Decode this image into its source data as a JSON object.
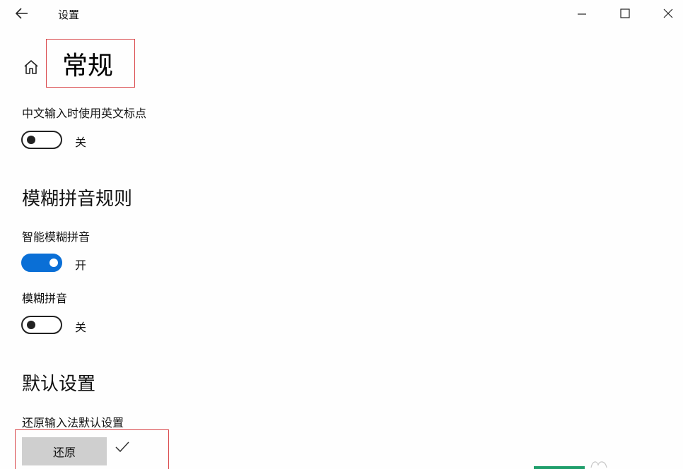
{
  "window": {
    "title": "设置"
  },
  "header": {
    "page_title": "常规"
  },
  "settings": {
    "english_punct": {
      "label": "中文输入时使用英文标点",
      "state_text": "关",
      "on": false
    },
    "fuzzy_section_title": "模糊拼音规则",
    "smart_fuzzy": {
      "label": "智能模糊拼音",
      "state_text": "开",
      "on": true
    },
    "fuzzy": {
      "label": "模糊拼音",
      "state_text": "关",
      "on": false
    },
    "default_section_title": "默认设置",
    "restore": {
      "label": "还原输入法默认设置",
      "button_label": "还原"
    }
  },
  "icons": {
    "back": "back-arrow-icon",
    "home": "home-icon",
    "minimize": "minimize-icon",
    "maximize": "maximize-icon",
    "close": "close-icon",
    "check": "check-icon"
  },
  "colors": {
    "accent": "#0a6fd6",
    "highlight_box": "#d9474a",
    "button_bg": "#cfcfcf"
  }
}
